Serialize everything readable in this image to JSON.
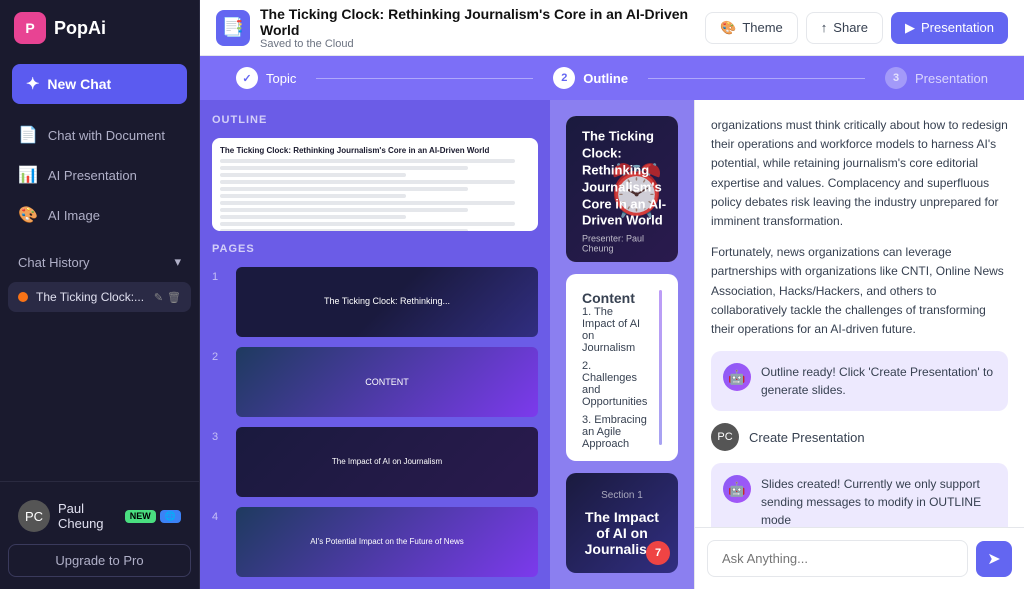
{
  "app": {
    "name": "PopAi",
    "logo_text": "PopAi"
  },
  "sidebar": {
    "new_chat_label": "New Chat",
    "nav_items": [
      {
        "id": "chat-document",
        "label": "Chat with Document",
        "icon": "📄"
      },
      {
        "id": "ai-presentation",
        "label": "AI Presentation",
        "icon": "📊"
      },
      {
        "id": "ai-image",
        "label": "AI Image",
        "icon": "🎨"
      }
    ],
    "chat_history_label": "Chat History",
    "history_items": [
      {
        "id": "ticking-clock",
        "label": "The Ticking Clock:..."
      }
    ],
    "user": {
      "name": "Paul Cheung",
      "badges": [
        "NEW",
        ""
      ]
    },
    "upgrade_label": "Upgrade to Pro"
  },
  "topbar": {
    "title": "The Ticking Clock: Rethinking Journalism's Core in an AI-Driven World",
    "subtitle": "Saved to the Cloud",
    "theme_label": "Theme",
    "share_label": "Share",
    "presentation_label": "Presentation"
  },
  "progress": {
    "steps": [
      {
        "num": "✓",
        "label": "Topic",
        "state": "done"
      },
      {
        "num": "2",
        "label": "Outline",
        "state": "active"
      },
      {
        "num": "3",
        "label": "Presentation",
        "state": "inactive"
      }
    ]
  },
  "editor": {
    "outline_label": "OUTLINE",
    "pages_label": "PAGES",
    "pages": [
      {
        "num": "1",
        "type": "cover"
      },
      {
        "num": "2",
        "type": "blue"
      },
      {
        "num": "3",
        "type": "dark"
      },
      {
        "num": "4",
        "type": "blue2"
      }
    ]
  },
  "slides": [
    {
      "type": "cover",
      "title": "The Ticking Clock: Rethinking Journalism's Core in an AI-Driven World",
      "presenter": "Presenter: Paul Cheung",
      "icon": "⏰"
    },
    {
      "type": "content",
      "label": "Content",
      "items": [
        "1. The Impact of AI on Journalism",
        "2. Challenges and Opportunities",
        "3. Embracing an Agile Approach"
      ]
    },
    {
      "type": "section",
      "section_num": "Section 1",
      "title": "The Impact of AI on Journalism"
    }
  ],
  "chat": {
    "messages": [
      {
        "type": "text",
        "content": "organizations must think critically about how to redesign their operations and workforce models to harness AI's potential, while retaining journalism's core editorial expertise and values. Complacency and superfluous policy debates risk leaving the industry unprepared for imminent transformation."
      },
      {
        "type": "text",
        "content": "Fortunately, news organizations can leverage partnerships with organizations like CNTI, Online News Association, Hacks/Hackers, and others to collaboratively tackle the challenges of transforming their operations for an AI-driven future."
      },
      {
        "type": "ai",
        "content": "Outline ready! Click 'Create Presentation' to generate slides."
      },
      {
        "type": "user",
        "content": "Create Presentation"
      },
      {
        "type": "ai",
        "content": "Slides created! Currently we only support sending messages to modify in OUTLINE mode"
      }
    ],
    "input_placeholder": "Ask Anything...",
    "send_icon": "➤"
  }
}
